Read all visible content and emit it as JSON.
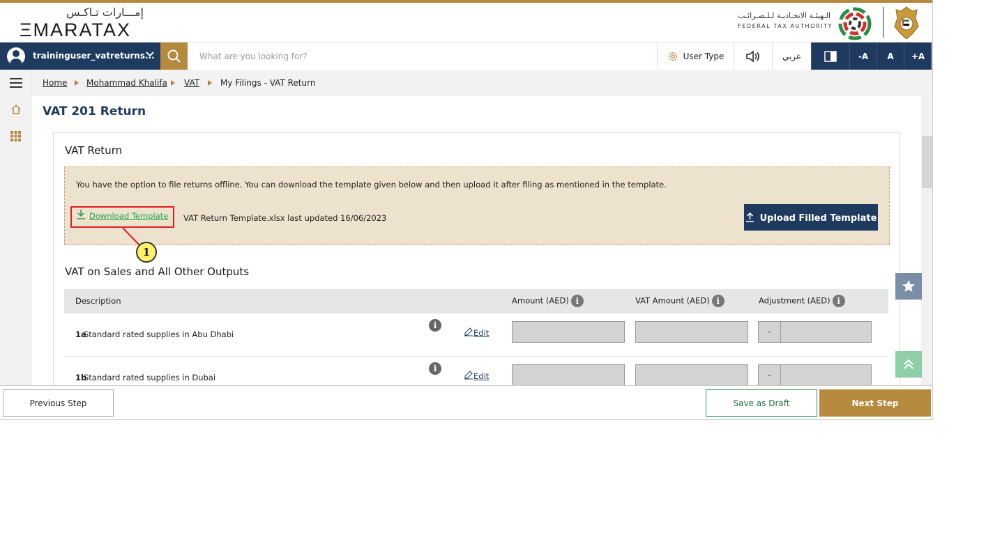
{
  "header": {
    "logo_arabic": "إمـــارات تـاكـس",
    "logo_english": "ΞMARATAX",
    "authority_arabic": "الـهيئـة الاتحـاديـة لـلـضـرائـب",
    "authority_english": "FEDERAL TAX AUTHORITY",
    "accent_color": "#b5893e",
    "primary_color": "#1e3a5f"
  },
  "toolbar": {
    "user_name": "traininguser_vatreturns...",
    "search_placeholder": "What are you looking for?",
    "user_type_label": "User Type",
    "arabic_label": "عربي",
    "font_decrease": "-A",
    "font_normal": "A",
    "font_increase": "+A"
  },
  "breadcrumb": {
    "items": [
      "Home",
      "Mohammad Khalifa",
      "VAT",
      "My Filings - VAT Return"
    ]
  },
  "main": {
    "page_title": "VAT 201 Return",
    "card_title": "VAT Return",
    "info_text": "You have the option to file returns offline. You can download the template given below and then upload it after filing as mentioned in the template.",
    "download_label": "Download Template",
    "template_info": "VAT Return Template.xlsx last updated 16/06/2023",
    "upload_label": "Upload Filled Template",
    "section_title": "VAT on Sales and All Other Outputs"
  },
  "table": {
    "headers": {
      "description": "Description",
      "amount": "Amount (AED)",
      "vat_amount": "VAT Amount (AED)",
      "adjustment": "Adjustment (AED)"
    },
    "rows": [
      {
        "code": "1a",
        "description": "Standard rated supplies in Abu Dhabi",
        "edit": "Edit",
        "adj_sign": "-"
      },
      {
        "code": "1b",
        "description": "Standard rated supplies in Dubai",
        "edit": "Edit",
        "adj_sign": "-"
      }
    ]
  },
  "annotation": {
    "step_number": "1"
  },
  "footer": {
    "previous_label": "Previous Step",
    "draft_label": "Save as Draft",
    "next_label": "Next Step"
  }
}
